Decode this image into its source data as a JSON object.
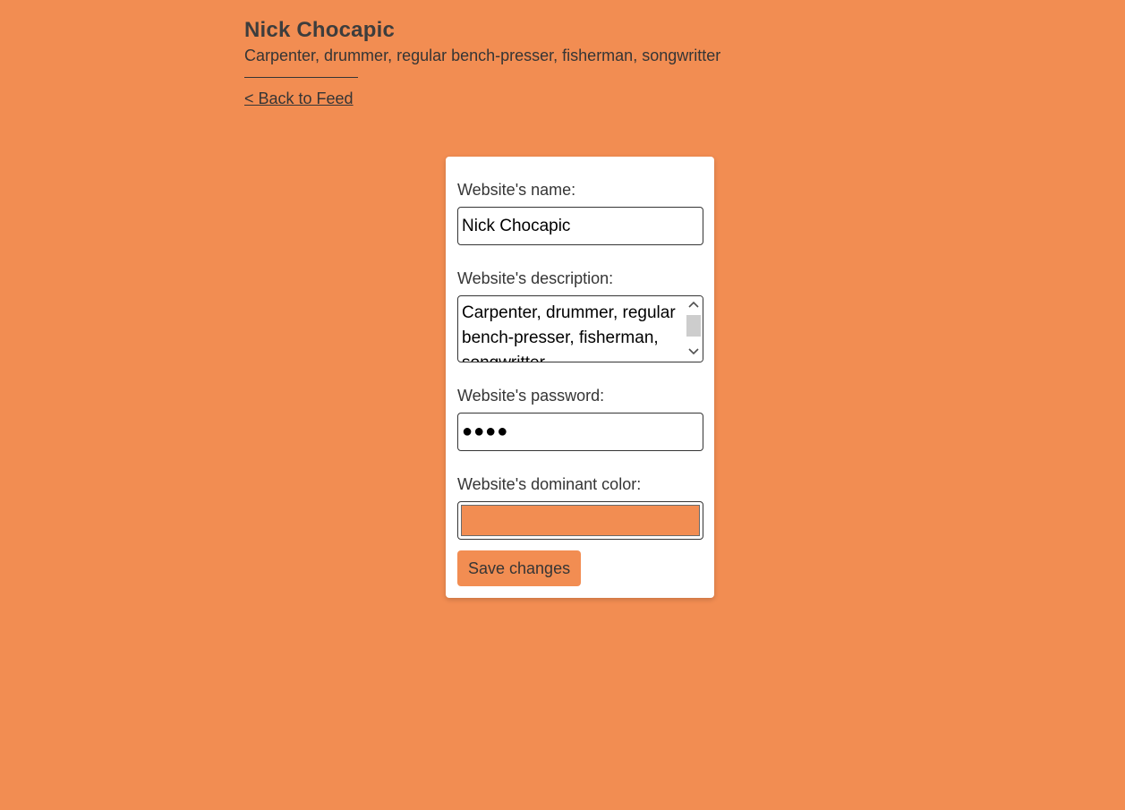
{
  "site": {
    "title": "Nick Chocapic",
    "description": "Carpenter, drummer, regular bench-presser, fisherman, songwritter",
    "back_link": "< Back to Feed"
  },
  "form": {
    "name_label": "Website's name:",
    "name_value": "Nick Chocapic",
    "description_label": "Website's description:",
    "description_value": "Carpenter, drummer, regular bench-presser, fisherman, songwritter",
    "password_label": "Website's password:",
    "password_masked": "●●●●",
    "color_label": "Website's dominant color:",
    "color_value": "#f28d52",
    "save_label": "Save changes"
  },
  "colors": {
    "background": "#f28d52",
    "card": "#ffffff",
    "text": "#353535"
  },
  "icons": {
    "scroll_up": "chevron-up-icon",
    "scroll_down": "chevron-down-icon"
  }
}
